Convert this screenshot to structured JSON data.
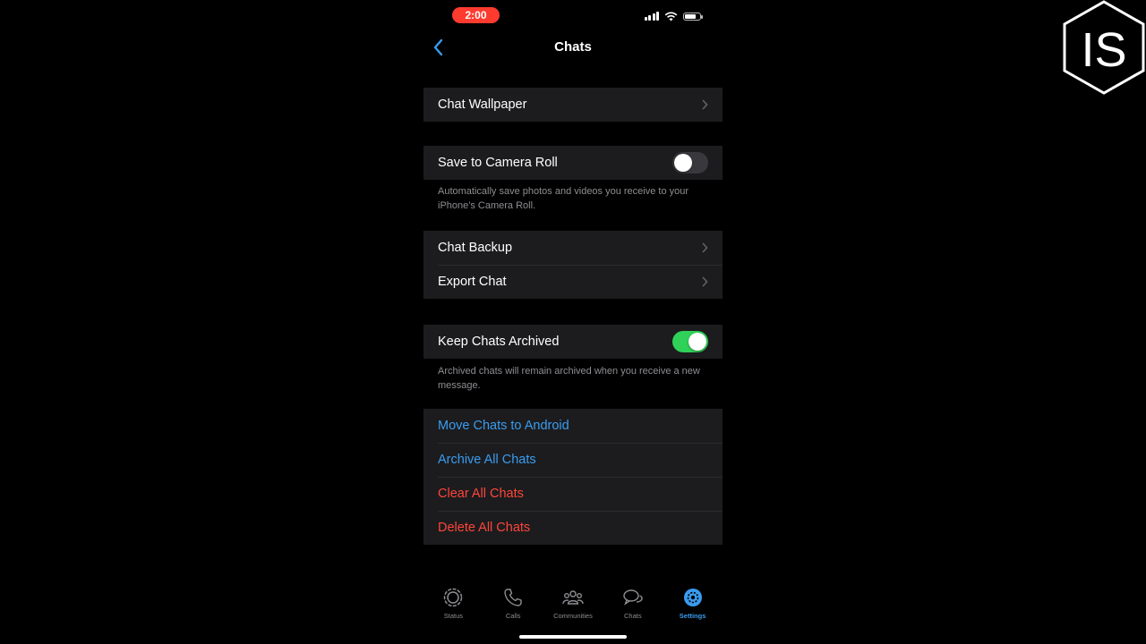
{
  "status_bar": {
    "time": "2:00"
  },
  "nav": {
    "title": "Chats"
  },
  "sections": {
    "wallpaper": {
      "label": "Chat Wallpaper"
    },
    "camera_roll": {
      "label": "Save to Camera Roll",
      "enabled": false,
      "footnote": "Automatically save photos and videos you receive to your iPhone's Camera Roll."
    },
    "backup": {
      "label": "Chat Backup"
    },
    "export": {
      "label": "Export Chat"
    },
    "keep_archived": {
      "label": "Keep Chats Archived",
      "enabled": true,
      "footnote": "Archived chats will remain archived when you receive a new message."
    },
    "actions": [
      {
        "label": "Move Chats to Android",
        "style": "blue"
      },
      {
        "label": "Archive All Chats",
        "style": "blue"
      },
      {
        "label": "Clear All Chats",
        "style": "red"
      },
      {
        "label": "Delete All Chats",
        "style": "red"
      }
    ]
  },
  "tabbar": {
    "status": "Status",
    "calls": "Calls",
    "communities": "Communities",
    "chats": "Chats",
    "settings": "Settings"
  },
  "colors": {
    "accent": "#3a9cf0",
    "destructive": "#ff453a",
    "toggle_on": "#30d158",
    "cell_bg": "#1c1c1e"
  },
  "logo": {
    "text": "IS"
  }
}
